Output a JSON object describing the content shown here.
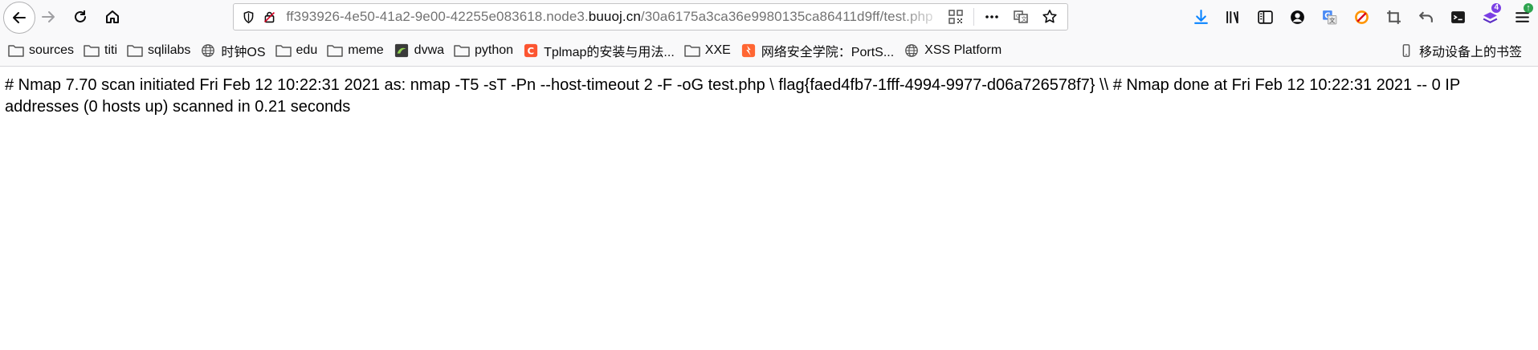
{
  "urlbar": {
    "url_prefix": "ff393926-4e50-41a2-9e00-42255e083618.node3.",
    "url_host": "buuoj.cn",
    "url_path": "/30a6175a3ca36e9980135ca86411d9ff/test.php"
  },
  "bookmarks": [
    {
      "label": "sources",
      "icon": "folder-icon"
    },
    {
      "label": "titi",
      "icon": "folder-icon"
    },
    {
      "label": "sqlilabs",
      "icon": "folder-icon"
    },
    {
      "label": "时钟OS",
      "icon": "globe-icon"
    },
    {
      "label": "edu",
      "icon": "folder-icon"
    },
    {
      "label": "meme",
      "icon": "folder-icon"
    },
    {
      "label": "dvwa",
      "icon": "dvwa-icon"
    },
    {
      "label": "python",
      "icon": "folder-icon"
    },
    {
      "label": "Tplmap的安装与用法...",
      "icon": "c-logo-icon"
    },
    {
      "label": "XXE",
      "icon": "folder-icon"
    },
    {
      "label": "网络安全学院：PortS...",
      "icon": "portswigger-icon"
    },
    {
      "label": "XSS Platform",
      "icon": "globe-icon"
    }
  ],
  "mobile_bookmarks": "移动设备上的书签",
  "toolbar_badges": {
    "extension_count": "4",
    "menu_update": "↑"
  },
  "content": {
    "text": "# Nmap 7.70 scan initiated Fri Feb 12 10:22:31 2021 as: nmap -T5 -sT -Pn --host-timeout 2 -F -oG test.php \\ flag{faed4fb7-1fff-4994-9977-d06a726578f7} \\\\ # Nmap done at Fri Feb 12 10:22:31 2021 -- 0 IP addresses (0 hosts up) scanned in 0.21 seconds"
  }
}
